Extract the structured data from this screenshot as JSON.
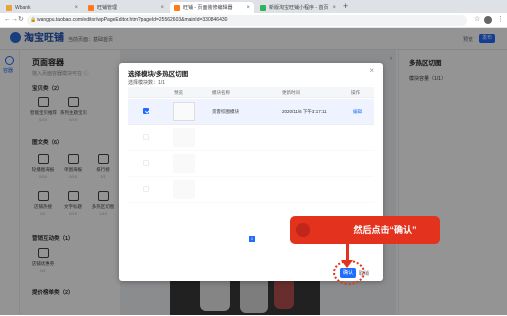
{
  "browser": {
    "tabs": [
      {
        "label": "Wbank",
        "color": "#e8a33d"
      },
      {
        "label": "旺铺管理",
        "color": "#ff7a1a"
      },
      {
        "label": "旺铺 - 页面装修编辑器",
        "color": "#ff7a1a"
      },
      {
        "label": "新版淘宝旺铺小程序 - 首页",
        "color": "#2db55d"
      }
    ],
    "url": "wangpu.taobao.com/editor/wpPageEditor.htm?pageId=25562603&mainId=330846430"
  },
  "app": {
    "brand": "淘宝旺铺",
    "crumb": "当前页面：基础首页",
    "preview": "预览",
    "save": "发布"
  },
  "rail": {
    "label": "容器"
  },
  "left_panel": {
    "title": "页面容器",
    "subtitle": "拖入页面容器模块可在 ⓘ",
    "sections": [
      {
        "label": "宝贝类（2）",
        "items": [
          {
            "name": "智能宝贝推荐",
            "count": "0/19"
          },
          {
            "name": "系列主题宝贝",
            "count": "0/19"
          }
        ]
      },
      {
        "label": "图文类（6）",
        "items": [
          {
            "name": "轮播图海报",
            "count": "0/19"
          },
          {
            "name": "单图海报",
            "count": "0/19"
          },
          {
            "name": "排行榜",
            "count": "1/1"
          },
          {
            "name": "店铺热搜",
            "count": "0/1"
          },
          {
            "name": "文字标题",
            "count": "0/19"
          },
          {
            "name": "多热区切图",
            "count": "1/19"
          }
        ]
      },
      {
        "label": "营销互动类（1）",
        "items": [
          {
            "name": "店铺优惠券",
            "count": "0/1"
          }
        ]
      },
      {
        "label": "提价榜单类（2）",
        "items": []
      }
    ]
  },
  "right_panel": {
    "title": "多热区切图",
    "subtitle": "模块容量（1/1）"
  },
  "modal": {
    "title": "选择模块/多热区切图",
    "count": "选择模块数：1/1",
    "headers": [
      "预览",
      "模块名称",
      "更新时间",
      "操作"
    ],
    "rows": [
      {
        "checked": true,
        "name": "货客综图模块",
        "time": "2020/11/6 下午3:17:11",
        "action": "编辑"
      },
      {
        "checked": false,
        "name": "",
        "time": "",
        "action": ""
      },
      {
        "checked": false,
        "name": "",
        "time": "",
        "action": ""
      },
      {
        "checked": false,
        "name": "",
        "time": "",
        "action": ""
      }
    ],
    "page": "1",
    "ok": "确认",
    "cancel": "取消"
  },
  "annotation": {
    "text": "然后点击“确认”",
    "color": "#e3321d"
  }
}
